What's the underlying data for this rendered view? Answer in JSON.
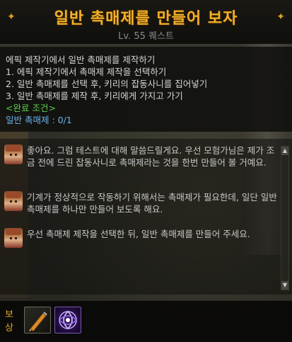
{
  "quest": {
    "title": "일반 촉매제를 만들어 보자",
    "subtitle": "Lv. 55 퀘스트"
  },
  "info": {
    "lines": [
      "에픽 제작기에서 일반 촉매제를 제작하기",
      "1. 에픽 제작기에서 촉매제 제작을 선택하기",
      "2. 일반 촉매제를 선택 후, 키리의 잡동사니를 집어넣기",
      "3. 일반 촉매제를 제작 후, 키리에게 가지고 가기"
    ],
    "condition_label": "<완료 조건>",
    "progress": "일반 촉매제 : 0/1"
  },
  "dialog": {
    "messages": [
      "좋아요. 그럼 테스트에 대해 말씀드릴게요. 우선 모험가님은 제가 조금 전에 드린 잡동사니로 촉매제라는 것을 한번 만들어 볼 거예요.",
      "기계가 정상적으로 작동하기 위해서는 촉매제가 필요한데, 일단 일반 촉매제를 하나만 만들어 보도록 해요.",
      "우선 촉매제 제작을 선택한 뒤, 일반 촉매제를 만들어 주세요."
    ]
  },
  "reward": {
    "label": "보상",
    "items": [
      "pencil-icon",
      "magic-sigil-icon"
    ]
  },
  "colors": {
    "title": "#f2b02a",
    "condition": "#5ccf4a",
    "progress": "#6ab4e8",
    "reward_label": "#e2a92a"
  }
}
